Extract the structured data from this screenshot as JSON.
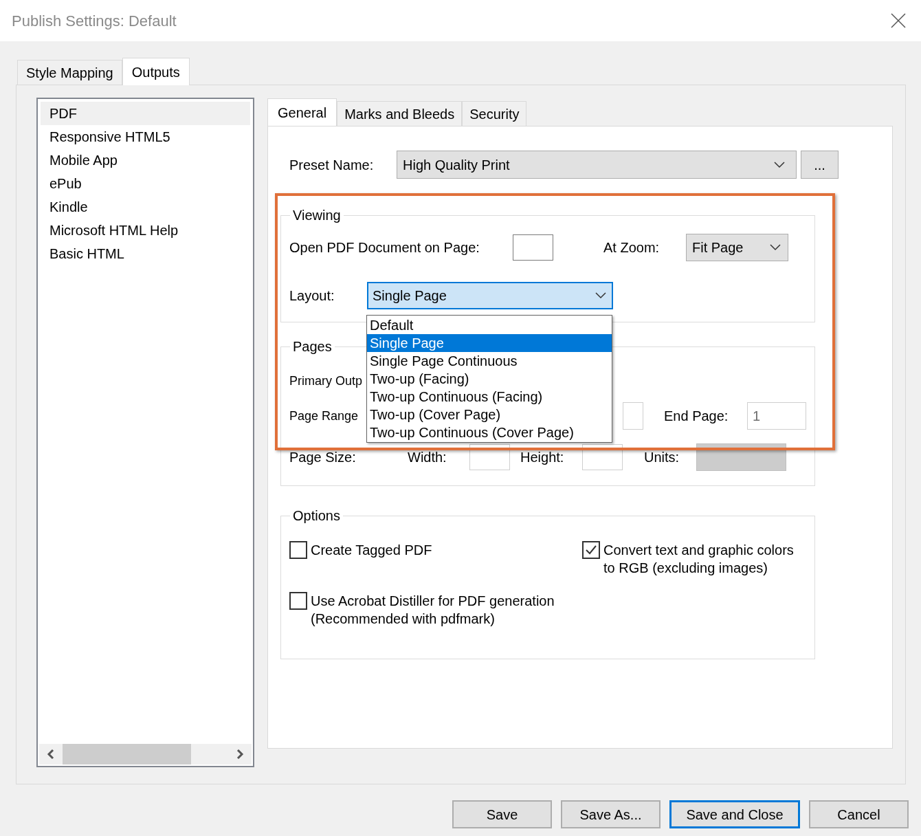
{
  "window": {
    "title": "Publish Settings: Default"
  },
  "tabs": [
    {
      "label": "Style Mapping",
      "selected": false
    },
    {
      "label": "Outputs",
      "selected": true
    }
  ],
  "outputs": [
    {
      "label": "PDF",
      "selected": true
    },
    {
      "label": "Responsive HTML5",
      "selected": false
    },
    {
      "label": "Mobile App",
      "selected": false
    },
    {
      "label": "ePub",
      "selected": false
    },
    {
      "label": "Kindle",
      "selected": false
    },
    {
      "label": "Microsoft HTML Help",
      "selected": false
    },
    {
      "label": "Basic HTML",
      "selected": false
    }
  ],
  "subtabs": [
    {
      "label": "General",
      "selected": true
    },
    {
      "label": "Marks and Bleeds",
      "selected": false
    },
    {
      "label": "Security",
      "selected": false
    }
  ],
  "preset": {
    "label": "Preset Name:",
    "value": "High Quality Print",
    "more": "..."
  },
  "viewing": {
    "title": "Viewing",
    "open_label": "Open PDF Document on Page:",
    "zoom_label": "At Zoom:",
    "zoom_value": "Fit Page",
    "layout_label": "Layout:",
    "layout_value": "Single Page",
    "layout_options": [
      {
        "label": "Default",
        "selected": false
      },
      {
        "label": "Single Page",
        "selected": true
      },
      {
        "label": "Single Page Continuous",
        "selected": false
      },
      {
        "label": "Two-up (Facing)",
        "selected": false
      },
      {
        "label": "Two-up Continuous (Facing)",
        "selected": false
      },
      {
        "label": "Two-up (Cover Page)",
        "selected": false
      },
      {
        "label": "Two-up Continuous (Cover Page)",
        "selected": false
      }
    ]
  },
  "pages": {
    "title": "Pages",
    "primary_label": "Primary Outp",
    "range_label": "Page Range",
    "end_label": "End Page:",
    "end_value": "1",
    "size_label": "Page Size:",
    "width_label": "Width:",
    "height_label": "Height:",
    "units_label": "Units:"
  },
  "options": {
    "title": "Options",
    "items": [
      {
        "lines": [
          "Create Tagged PDF"
        ],
        "checked": false
      },
      {
        "lines": [
          "Use Acrobat Distiller for PDF generation",
          "(Recommended with pdfmark)"
        ],
        "checked": false
      },
      {
        "lines": [
          "Convert text and graphic colors",
          "to RGB (excluding images)"
        ],
        "checked": true
      }
    ]
  },
  "buttons": [
    {
      "label": "Save",
      "default": false
    },
    {
      "label": "Save As...",
      "default": false
    },
    {
      "label": "Save and Close",
      "default": true
    },
    {
      "label": "Cancel",
      "default": false
    }
  ]
}
